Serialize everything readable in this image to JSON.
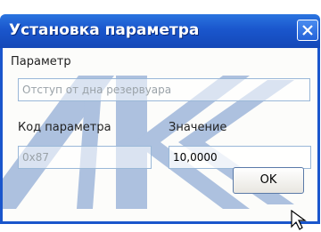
{
  "window": {
    "title": "Установка параметра"
  },
  "parameter": {
    "label": "Параметр",
    "value": "Отступ от дна резервуара"
  },
  "code": {
    "label": "Код параметра",
    "value": "0x87"
  },
  "value": {
    "label": "Значение",
    "value": "10,0000"
  },
  "ok_button": {
    "label": "OK"
  },
  "colors": {
    "titlebar": "#1a56cc",
    "watermark": "#2f63b8"
  },
  "icons": {
    "close": "close-icon",
    "cursor": "mouse-cursor-icon"
  }
}
